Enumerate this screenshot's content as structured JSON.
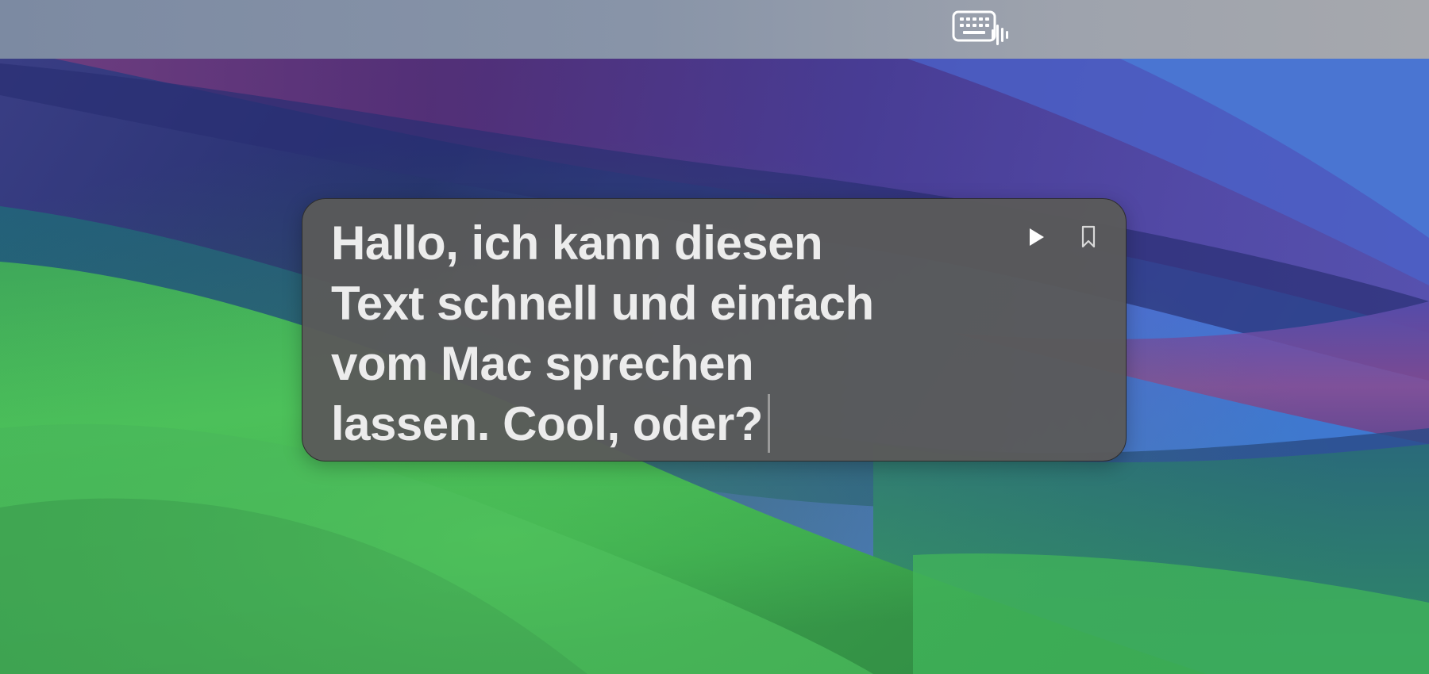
{
  "menubar": {
    "keyboard_speech_icon": "keyboard-speech-icon"
  },
  "speak_panel": {
    "text": "Hallo, ich kann diesen Text schnell und einfach vom Mac sprechen lassen. Cool, oder?",
    "play_icon": "play-icon",
    "bookmark_icon": "bookmark-icon"
  },
  "colors": {
    "panel_background": "#5a5a5a",
    "panel_text": "#ececec",
    "menubar": "#8894a8"
  }
}
